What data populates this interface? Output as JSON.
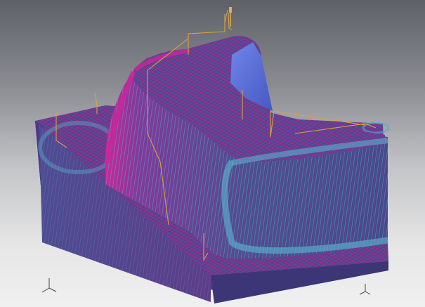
{
  "viewport": {
    "kind": "cam-toolpath-3d-view",
    "background_gradient": [
      "#5f6168",
      "#8a8c92",
      "#c4c5c8",
      "#f0f0f0"
    ]
  },
  "colors": {
    "part_body": "#4f3f8a",
    "part_side": "#5a3e86",
    "toolpath_magenta": "#c8279a",
    "toolpath_cyan": "#5aa9c8",
    "toolpath_dark": "#3b3f86",
    "tool_link_orange": "#d8a23a",
    "flat_face_blue": "#5b6fd6"
  },
  "icons": {
    "triad_left": "xyz-axis-triad-icon",
    "triad_right": "xyz-axis-triad-icon",
    "tool": "cutting-tool-icon"
  }
}
